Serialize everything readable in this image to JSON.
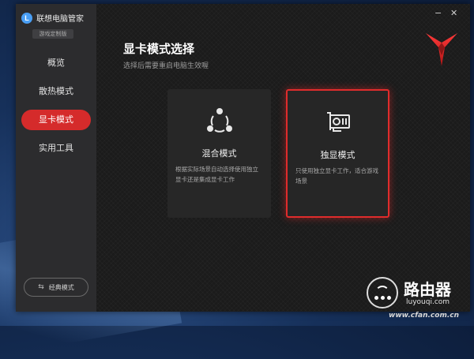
{
  "app": {
    "logo_letter": "L",
    "title": "联想电脑管家",
    "edition": "游戏定制版"
  },
  "sidebar": {
    "items": [
      {
        "label": "概览",
        "active": false
      },
      {
        "label": "散热模式",
        "active": false
      },
      {
        "label": "显卡模式",
        "active": true
      },
      {
        "label": "实用工具",
        "active": false
      }
    ],
    "classic_button": "经典模式"
  },
  "window_controls": {
    "minimize": "−",
    "close": "✕"
  },
  "main": {
    "title": "显卡模式选择",
    "subtitle": "选择后需要重启电脑生效喔",
    "cards": [
      {
        "title": "混合模式",
        "description": "根据实际场景自动选择使用独立显卡还是集成显卡工作",
        "selected": false,
        "icon": "share-nodes-icon"
      },
      {
        "title": "独显模式",
        "description": "只使用独立显卡工作，适合游戏场景",
        "selected": true,
        "icon": "graphics-card-icon"
      }
    ]
  },
  "watermark": {
    "name": "路由器",
    "domain": "luyouqi.com",
    "site": "www.cfan.com.cn"
  },
  "colors": {
    "accent": "#d52b2b",
    "sidebar": "#2c2c2e",
    "main_bg": "#1b1b1b",
    "card_bg": "#272727",
    "logo_blue": "#4a9ff5"
  }
}
